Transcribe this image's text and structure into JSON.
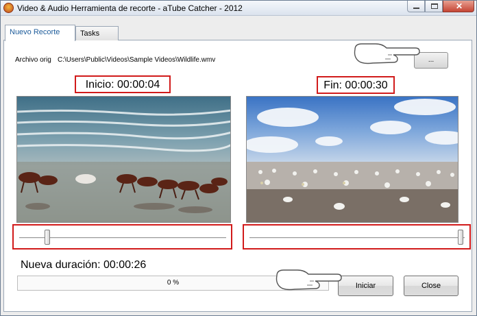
{
  "window": {
    "title": "Video & Audio Herramienta de recorte - aTube Catcher - 2012"
  },
  "tabs": [
    {
      "label": "Nuevo Recorte",
      "active": true
    },
    {
      "label": "Tasks",
      "active": false
    }
  ],
  "source": {
    "label": "Archivo orig",
    "path": "C:\\Users\\Public\\Videos\\Sample Videos\\Wildlife.wmv",
    "browse_label": "..."
  },
  "start": {
    "label": "Inicio: 00:00:04",
    "slider_fraction": 0.14
  },
  "end": {
    "label": "Fin: 00:00:30",
    "slider_fraction": 0.99
  },
  "preview": {
    "left_icon": "horses-frame",
    "right_icon": "birds-frame"
  },
  "duration": {
    "label": "Nueva duración: 00:00:26"
  },
  "progress": {
    "text": "0 %",
    "value": 0
  },
  "buttons": {
    "start": "Iniciar",
    "close": "Close"
  },
  "colors": {
    "highlight": "#d11a1a",
    "accent": "#1c5b9a"
  }
}
